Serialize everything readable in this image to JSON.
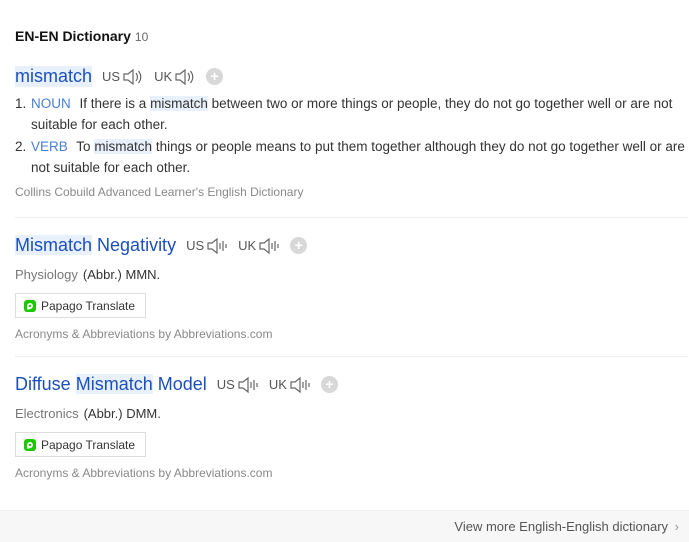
{
  "header": {
    "title": "EN-EN Dictionary",
    "count": "10"
  },
  "entries": [
    {
      "word": "mismatch",
      "us_label": "US",
      "uk_label": "UK",
      "definitions": [
        {
          "num": "1.",
          "pos": "NOUN",
          "pre": "If there is a",
          "hl": "mismatch",
          "post": "between two or more things or people, they do not go together well or are not suitable for each other."
        },
        {
          "num": "2.",
          "pos": "VERB",
          "pre": "To",
          "hl": "mismatch",
          "post": "things or people means to put them together although they do not go together well or are not suitable for each other."
        }
      ],
      "source": "Collins Cobuild Advanced Learner's English Dictionary"
    },
    {
      "word_hl": "Mismatch",
      "word_rest": "Negativity",
      "us_label": "US",
      "uk_label": "UK",
      "category": "Physiology",
      "abbr": "(Abbr.) MMN.",
      "papago": "Papago Translate",
      "source": "Acronyms & Abbreviations by Abbreviations.com"
    },
    {
      "word_pre": "Diffuse",
      "word_hl": "Mismatch",
      "word_rest": "Model",
      "us_label": "US",
      "uk_label": "UK",
      "category": "Electronics",
      "abbr": "(Abbr.) DMM.",
      "papago": "Papago Translate",
      "source": "Acronyms & Abbreviations by Abbreviations.com"
    }
  ],
  "footer": {
    "more_link": "View more English-English dictionary",
    "chevron": "›"
  },
  "icons": [
    "speaker-icon",
    "plus-icon",
    "papago-icon",
    "chevron-right-icon"
  ],
  "colors": {
    "link": "#1b4fbb",
    "pos": "#4a7fd0",
    "highlight": "#e8f1fb"
  }
}
